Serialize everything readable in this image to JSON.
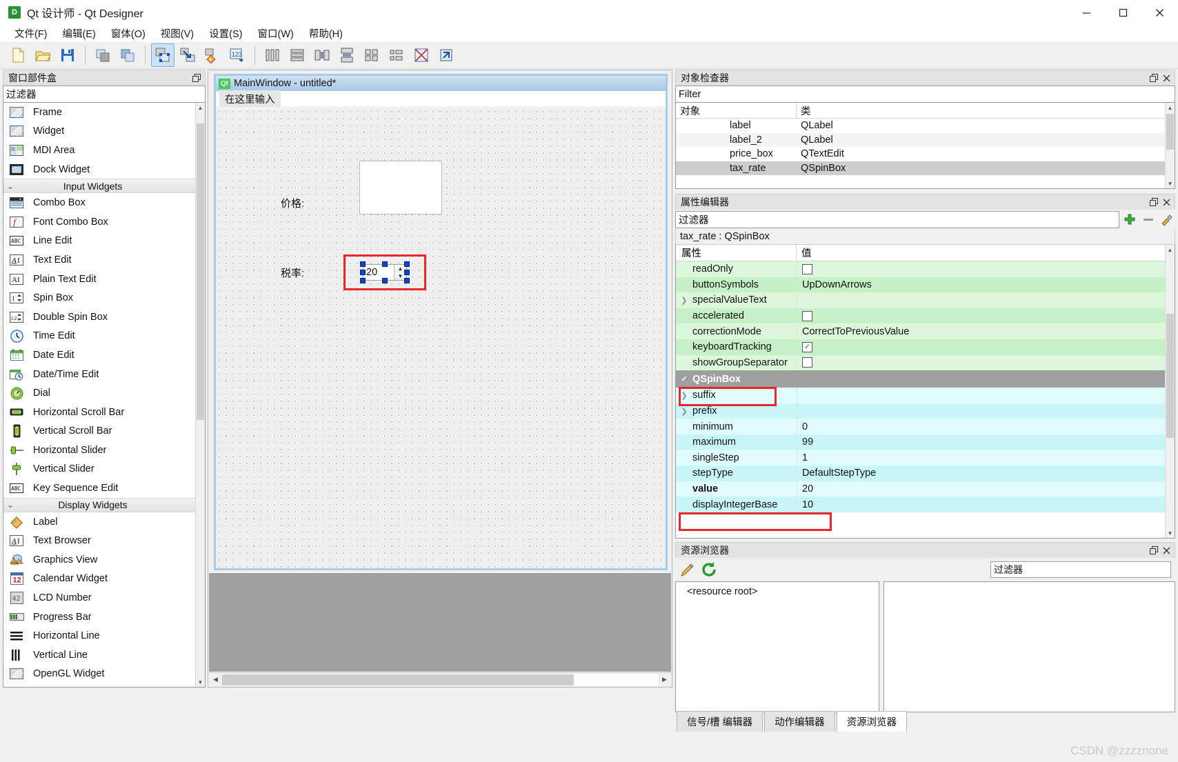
{
  "window": {
    "title": "Qt 设计师 - Qt Designer",
    "app_icon": "qt-designer-icon",
    "minimize": "–",
    "maximize": "□",
    "close": "✕"
  },
  "menubar": {
    "items": [
      {
        "label": "文件(F)",
        "name": "menu-file"
      },
      {
        "label": "编辑(E)",
        "name": "menu-edit"
      },
      {
        "label": "窗体(O)",
        "name": "menu-form"
      },
      {
        "label": "视图(V)",
        "name": "menu-view"
      },
      {
        "label": "设置(S)",
        "name": "menu-settings"
      },
      {
        "label": "窗口(W)",
        "name": "menu-window"
      },
      {
        "label": "帮助(H)",
        "name": "menu-help"
      }
    ]
  },
  "toolbar": {
    "buttons": [
      {
        "name": "new-form-button",
        "icon": "new-file-icon"
      },
      {
        "name": "open-form-button",
        "icon": "open-folder-icon"
      },
      {
        "name": "save-form-button",
        "icon": "save-disk-icon"
      },
      {
        "name": "cut-button",
        "icon": "copy-icon"
      },
      {
        "name": "paste-button",
        "icon": "paste-icon"
      },
      {
        "name": "edit-widgets-button",
        "icon": "edit-widgets-icon",
        "active": true
      },
      {
        "name": "edit-signals-slots-button",
        "icon": "signals-slots-icon"
      },
      {
        "name": "edit-buddies-button",
        "icon": "buddies-icon"
      },
      {
        "name": "edit-tab-order-button",
        "icon": "tab-order-icon"
      },
      {
        "name": "layout-horizontally-button",
        "icon": "layout-horizontal-icon"
      },
      {
        "name": "layout-vertically-button",
        "icon": "layout-vertical-icon"
      },
      {
        "name": "layout-splitter-h-button",
        "icon": "splitter-horizontal-icon"
      },
      {
        "name": "layout-splitter-v-button",
        "icon": "splitter-vertical-icon"
      },
      {
        "name": "layout-grid-button",
        "icon": "layout-grid-icon"
      },
      {
        "name": "layout-form-button",
        "icon": "layout-form-icon"
      },
      {
        "name": "break-layout-button",
        "icon": "break-layout-icon"
      },
      {
        "name": "adjust-size-button",
        "icon": "adjust-size-icon"
      }
    ]
  },
  "widget_box": {
    "title": "窗口部件盒",
    "filter_value": "过滤器",
    "float_icon": "float-icon",
    "items": [
      {
        "type": "item",
        "label": "Frame",
        "icon": "frame-icon"
      },
      {
        "type": "item",
        "label": "Widget",
        "icon": "widget-icon"
      },
      {
        "type": "item",
        "label": "MDI Area",
        "icon": "mdi-area-icon"
      },
      {
        "type": "item",
        "label": "Dock Widget",
        "icon": "dock-widget-icon"
      },
      {
        "type": "category",
        "label": "Input Widgets"
      },
      {
        "type": "item",
        "label": "Combo Box",
        "icon": "combo-box-icon"
      },
      {
        "type": "item",
        "label": "Font Combo Box",
        "icon": "font-combo-box-icon"
      },
      {
        "type": "item",
        "label": "Line Edit",
        "icon": "line-edit-icon"
      },
      {
        "type": "item",
        "label": "Text Edit",
        "icon": "text-edit-icon"
      },
      {
        "type": "item",
        "label": "Plain Text Edit",
        "icon": "plain-text-edit-icon"
      },
      {
        "type": "item",
        "label": "Spin Box",
        "icon": "spin-box-icon"
      },
      {
        "type": "item",
        "label": "Double Spin Box",
        "icon": "double-spin-box-icon"
      },
      {
        "type": "item",
        "label": "Time Edit",
        "icon": "time-edit-icon"
      },
      {
        "type": "item",
        "label": "Date Edit",
        "icon": "date-edit-icon"
      },
      {
        "type": "item",
        "label": "Date/Time Edit",
        "icon": "date-time-edit-icon"
      },
      {
        "type": "item",
        "label": "Dial",
        "icon": "dial-icon"
      },
      {
        "type": "item",
        "label": "Horizontal Scroll Bar",
        "icon": "h-scrollbar-icon"
      },
      {
        "type": "item",
        "label": "Vertical Scroll Bar",
        "icon": "v-scrollbar-icon"
      },
      {
        "type": "item",
        "label": "Horizontal Slider",
        "icon": "h-slider-icon"
      },
      {
        "type": "item",
        "label": "Vertical Slider",
        "icon": "v-slider-icon"
      },
      {
        "type": "item",
        "label": "Key Sequence Edit",
        "icon": "key-sequence-edit-icon"
      },
      {
        "type": "category",
        "label": "Display Widgets"
      },
      {
        "type": "item",
        "label": "Label",
        "icon": "label-icon"
      },
      {
        "type": "item",
        "label": "Text Browser",
        "icon": "text-browser-icon"
      },
      {
        "type": "item",
        "label": "Graphics View",
        "icon": "graphics-view-icon"
      },
      {
        "type": "item",
        "label": "Calendar Widget",
        "icon": "calendar-widget-icon"
      },
      {
        "type": "item",
        "label": "LCD Number",
        "icon": "lcd-number-icon"
      },
      {
        "type": "item",
        "label": "Progress Bar",
        "icon": "progress-bar-icon"
      },
      {
        "type": "item",
        "label": "Horizontal Line",
        "icon": "horizontal-line-icon"
      },
      {
        "type": "item",
        "label": "Vertical Line",
        "icon": "vertical-line-icon"
      },
      {
        "type": "item",
        "label": "OpenGL Widget",
        "icon": "opengl-widget-icon"
      }
    ]
  },
  "form_editor": {
    "mdi_title": "MainWindow - untitled*",
    "qt_badge": "Qt",
    "menu_placeholder": "在这里输入",
    "labels": {
      "price": "价格:",
      "tax": "税率:"
    },
    "spinbox_value": "20",
    "close_icon": "close-icon"
  },
  "object_inspector": {
    "title": "对象检查器",
    "filter_value": "Filter",
    "columns": [
      "对象",
      "类"
    ],
    "rows": [
      {
        "object": "label",
        "class": "QLabel",
        "selected": false
      },
      {
        "object": "label_2",
        "class": "QLabel",
        "selected": false
      },
      {
        "object": "price_box",
        "class": "QTextEdit",
        "selected": false
      },
      {
        "object": "tax_rate",
        "class": "QSpinBox",
        "selected": true
      }
    ],
    "float_icon": "float-icon",
    "close_icon": "close-icon"
  },
  "property_editor": {
    "title": "属性编辑器",
    "filter_value": "过滤器",
    "object_line": "tax_rate : QSpinBox",
    "columns": [
      "属性",
      "值"
    ],
    "tool_icons": [
      "add-icon",
      "remove-icon",
      "configure-icon"
    ],
    "rows": [
      {
        "name": "readOnly",
        "value": "",
        "kind": "checkbox",
        "checked": false,
        "group": "green",
        "expandable": false
      },
      {
        "name": "buttonSymbols",
        "value": "UpDownArrows",
        "kind": "text",
        "group": "green",
        "expandable": false
      },
      {
        "name": "specialValueText",
        "value": "",
        "kind": "text",
        "group": "green",
        "expandable": true
      },
      {
        "name": "accelerated",
        "value": "",
        "kind": "checkbox",
        "checked": false,
        "group": "green",
        "expandable": false
      },
      {
        "name": "correctionMode",
        "value": "CorrectToPreviousValue",
        "kind": "text",
        "group": "green",
        "expandable": false
      },
      {
        "name": "keyboardTracking",
        "value": "",
        "kind": "checkbox",
        "checked": true,
        "group": "green",
        "expandable": false
      },
      {
        "name": "showGroupSeparator",
        "value": "",
        "kind": "checkbox",
        "checked": false,
        "group": "green",
        "expandable": false
      },
      {
        "name": "QSpinBox",
        "value": "",
        "kind": "group-header",
        "group": "header",
        "expandable": false,
        "highlighted": true
      },
      {
        "name": "suffix",
        "value": "",
        "kind": "text",
        "group": "cyan",
        "expandable": true
      },
      {
        "name": "prefix",
        "value": "",
        "kind": "text",
        "group": "cyan",
        "expandable": true
      },
      {
        "name": "minimum",
        "value": "0",
        "kind": "text",
        "group": "cyan",
        "expandable": false
      },
      {
        "name": "maximum",
        "value": "99",
        "kind": "text",
        "group": "cyan",
        "expandable": false
      },
      {
        "name": "singleStep",
        "value": "1",
        "kind": "text",
        "group": "cyan",
        "expandable": false
      },
      {
        "name": "stepType",
        "value": "DefaultStepType",
        "kind": "text",
        "group": "cyan",
        "expandable": false
      },
      {
        "name": "value",
        "value": "20",
        "kind": "text",
        "group": "cyan",
        "expandable": false,
        "bold": true,
        "highlighted": true
      },
      {
        "name": "displayIntegerBase",
        "value": "10",
        "kind": "text",
        "group": "cyan",
        "expandable": false
      }
    ],
    "float_icon": "float-icon",
    "close_icon": "close-icon"
  },
  "resource_browser": {
    "title": "资源浏览器",
    "filter_value": "过滤器",
    "edit_icon": "pencil-icon",
    "reload_icon": "reload-icon",
    "root_label": "<resource root>",
    "tabs": [
      {
        "label": "信号/槽 编辑器",
        "active": false
      },
      {
        "label": "动作编辑器",
        "active": false
      },
      {
        "label": "资源浏览器",
        "active": true
      }
    ],
    "float_icon": "float-icon",
    "close_icon": "close-icon"
  },
  "watermark": "CSDN @zzzznone"
}
